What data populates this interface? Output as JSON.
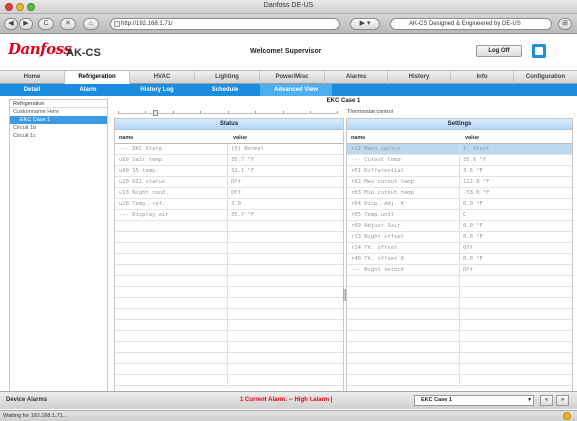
{
  "window": {
    "title": "Danfoss DE-US"
  },
  "browser": {
    "back": "◀",
    "forward": "▶",
    "reload": "C",
    "stop": "✕",
    "home": "⌂",
    "url": "http://192.168.1.71/",
    "search": "AK-CS Designed & Engineered by DE-US"
  },
  "header": {
    "logo": "Danfoss",
    "product": "AK-CS",
    "welcome": "Welcome! Supervisor",
    "logoff": "Log Off"
  },
  "main_tabs": [
    "Home",
    "Refrigeration",
    "HVAC",
    "Lighting",
    "Power/Misc",
    "Alarms",
    "History",
    "Info",
    "Configuration"
  ],
  "sub_tabs": [
    "Detail",
    "Alarm",
    "History Log",
    "Schedule",
    "Advanced View"
  ],
  "tree": {
    "header": "Refrigeration",
    "items": [
      "Customname Here",
      "EKC Case 1",
      "Circuit 1b",
      "Circuit 1c"
    ]
  },
  "case": {
    "title": "EKC Case 1",
    "slider_label": "Thermostat control",
    "slider_position": 0.16
  },
  "status": {
    "title": "Status",
    "col_name": "name",
    "col_value": "value",
    "rows": [
      {
        "name": "--- EKC State",
        "value": "[0] Normal"
      },
      {
        "name": "u69 Sair temp",
        "value": "35.7 °F"
      },
      {
        "name": "u09 S5 temp.",
        "value": "32.1 °F"
      },
      {
        "name": "u10 DI1 status",
        "value": "Off"
      },
      {
        "name": "u13 Night cond.",
        "value": "Off"
      },
      {
        "name": "u28 Temp. ref.",
        "value": "2.0"
      },
      {
        "name": "--- Display air",
        "value": "35.7 °F"
      }
    ]
  },
  "settings": {
    "title": "Settings",
    "col_name": "name",
    "col_value": "value",
    "rows": [
      {
        "name": "r12 Main switch",
        "value": "1: Start"
      },
      {
        "name": "--- Cutout temp",
        "value": "35.6 °F"
      },
      {
        "name": "r01 Differential",
        "value": "3.6 °F"
      },
      {
        "name": "r02 Max cutout temp",
        "value": "122.0 °F"
      },
      {
        "name": "r03 Min cutout temp",
        "value": "-58.0 °F"
      },
      {
        "name": "r04 Disp. Adj. K",
        "value": "0.0 °F"
      },
      {
        "name": "r05 Temp.unit",
        "value": "C"
      },
      {
        "name": "r09 Adjust Sair",
        "value": "0.0 °F"
      },
      {
        "name": "r13 Night offset",
        "value": "0.0 °F"
      },
      {
        "name": "r14 Th. offset",
        "value": "Off"
      },
      {
        "name": "r40 Th. offset A",
        "value": "0.0 °F"
      },
      {
        "name": "--- Night setbck",
        "value": "Off"
      }
    ]
  },
  "footer": {
    "device_alarms": "Device Alarms",
    "alarm_message": "1 Current Alarm: -- High t.alarm |",
    "case_select": "EKC Case 1",
    "prev": "«",
    "next": "»"
  },
  "status_bar": "Waiting for 192.168.1.71..."
}
